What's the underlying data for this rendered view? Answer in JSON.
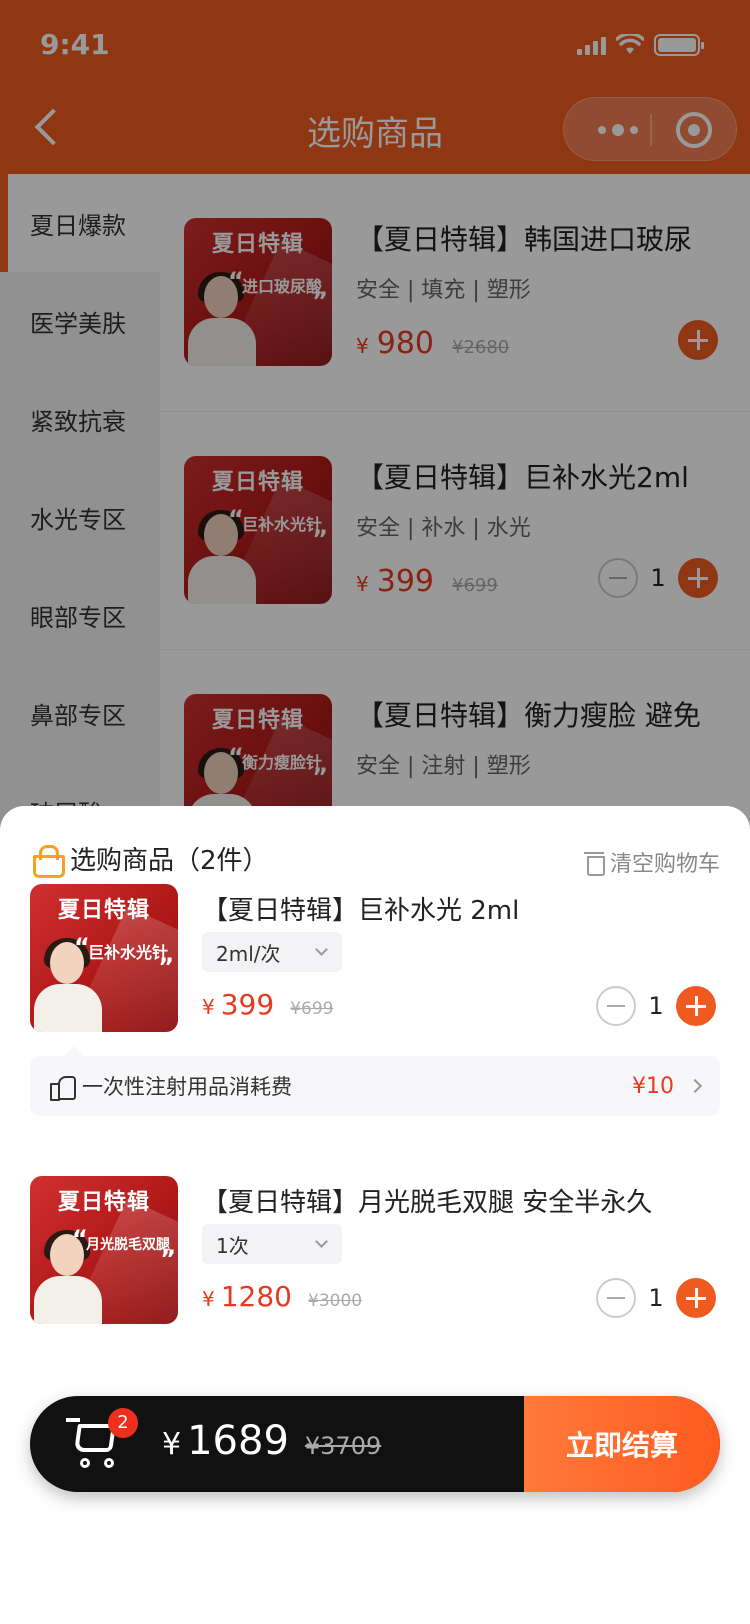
{
  "status_bar": {
    "time": "9:41"
  },
  "header": {
    "title": "选购商品"
  },
  "sidebar": {
    "items": [
      {
        "label": "夏日爆款"
      },
      {
        "label": "医学美肤"
      },
      {
        "label": "紧致抗衰"
      },
      {
        "label": "水光专区"
      },
      {
        "label": "眼部专区"
      },
      {
        "label": "鼻部专区"
      },
      {
        "label": "玻尿酸"
      }
    ]
  },
  "products": [
    {
      "title": "【夏日特辑】韩国进口玻尿",
      "tags": "安全 | 填充 | 塑形",
      "currency": "¥",
      "price": "980",
      "original_price": "¥2680",
      "thumb_title": "夏日特辑",
      "thumb_text": "进口玻尿酸"
    },
    {
      "title": "【夏日特辑】巨补水光2ml",
      "tags": "安全 | 补水 | 水光",
      "currency": "¥",
      "price": "399",
      "original_price": "¥699",
      "quantity": "1",
      "thumb_title": "夏日特辑",
      "thumb_text": "巨补水光针"
    },
    {
      "title": "【夏日特辑】衡力瘦脸 避免",
      "tags": "安全 | 注射 | 塑形",
      "thumb_title": "夏日特辑",
      "thumb_text": "衡力瘦脸针"
    }
  ],
  "cart": {
    "title": "选购商品（2件）",
    "clear_label": "清空购物车",
    "items": [
      {
        "title": "【夏日特辑】巨补水光 2ml",
        "spec": "2ml/次",
        "currency": "¥",
        "price": "399",
        "original_price": "¥699",
        "quantity": "1",
        "thumb_title": "夏日特辑",
        "thumb_text": "巨补水光针"
      },
      {
        "title": "【夏日特辑】月光脱毛双腿 安全半永久",
        "spec": "1次",
        "currency": "¥",
        "price": "1280",
        "original_price": "¥3000",
        "quantity": "1",
        "thumb_title": "夏日特辑",
        "thumb_text": "月光脱毛双腿"
      }
    ],
    "fee": {
      "label": "一次性注射用品消耗费",
      "price": "¥10"
    }
  },
  "checkout": {
    "badge_count": "2",
    "currency": "¥",
    "total": "1689",
    "original_total": "¥3709",
    "button_label": "立即结算"
  },
  "colors": {
    "brand": "#ee5a1f",
    "price": "#e83a20"
  }
}
